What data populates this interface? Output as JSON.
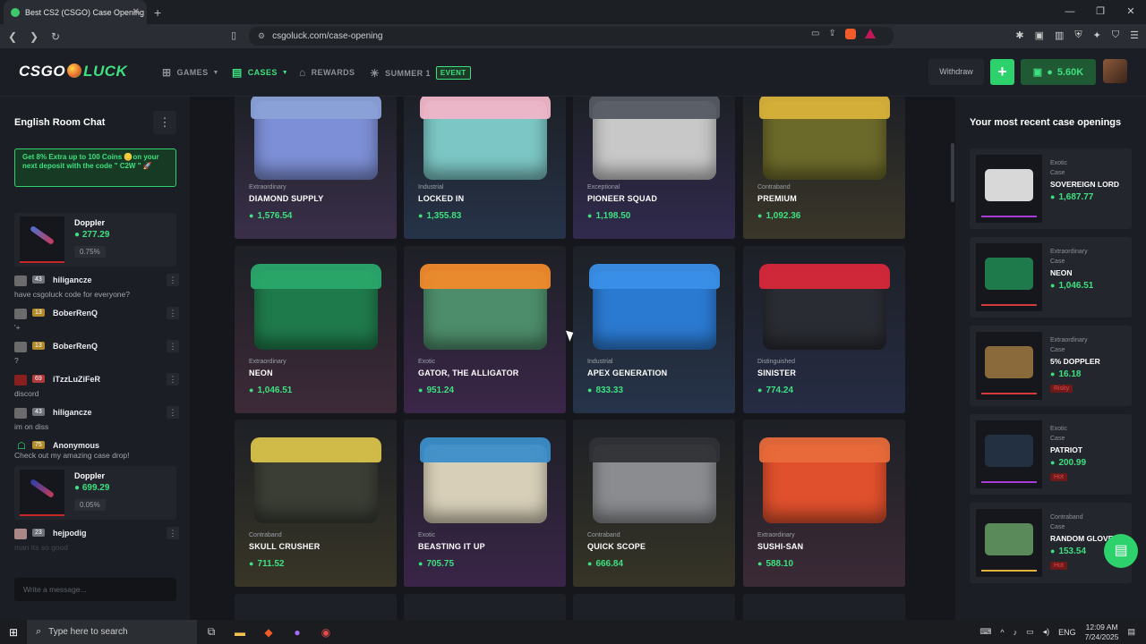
{
  "browser": {
    "tab_title": "Best CS2 (CSGO) Case Opening",
    "url": "csgoluck.com/case-opening"
  },
  "header": {
    "logo_left": "CSGO",
    "logo_right": "LUCK",
    "nav": [
      {
        "label": "GAMES",
        "has_caret": true
      },
      {
        "label": "CASES",
        "has_caret": true
      },
      {
        "label": "REWARDS"
      },
      {
        "label": "SUMMER 1"
      }
    ],
    "event_badge": "EVENT",
    "withdraw_label": "Withdraw",
    "plus_label": "+",
    "balance": "5.60K"
  },
  "chat": {
    "title": "English Room Chat",
    "promo": "Get 8% Extra up to 100 Coins 🪙on your next deposit with the code \" C2W \" 🚀",
    "drop1": {
      "name": "Doppler",
      "price": "277.29",
      "pct": "0.75%"
    },
    "messages": [
      {
        "level": "43",
        "user": "hiligancze",
        "text": "have csgoluck code for everyone?"
      },
      {
        "level": "13",
        "user": "BoberRenQ",
        "text": "'+"
      },
      {
        "level": "13",
        "user": "BoberRenQ",
        "text": "?"
      },
      {
        "level": "69",
        "user": "iTzzLuZiFeR",
        "text": "discord"
      },
      {
        "level": "43",
        "user": "hiligancze",
        "text": "im on diss"
      },
      {
        "level": "75",
        "user": "Anonymous",
        "text": "Check out my amazing case drop!"
      }
    ],
    "drop2": {
      "name": "Doppler",
      "price": "699.29",
      "pct": "0.05%"
    },
    "last_message": {
      "level": "23",
      "user": "hejpodig",
      "text": "man its so good"
    },
    "input_placeholder": "Write a message..."
  },
  "cases": [
    {
      "rarity": "Extraordinary",
      "name": "DIAMOND SUPPLY",
      "price": "1,576.54",
      "bg": "#3a2f4a",
      "color": "#7d8fd6",
      "lid": "#8ba2d8"
    },
    {
      "rarity": "Industrial",
      "name": "LOCKED IN",
      "price": "1,355.83",
      "bg": "#263348",
      "color": "#7cc7c5",
      "lid": "#f1b6c8"
    },
    {
      "rarity": "Exceptional",
      "name": "PIONEER SQUAD",
      "price": "1,198.50",
      "bg": "#312a4e",
      "color": "#c8c8c8",
      "lid": "#555a62"
    },
    {
      "rarity": "Contraband",
      "name": "PREMIUM",
      "price": "1,092.36",
      "bg": "#3a3628",
      "color": "#6c6a2a",
      "lid": "#d9b23a"
    },
    {
      "rarity": "Extraordinary",
      "name": "NEON",
      "price": "1,046.51",
      "bg": "#3d2a38",
      "color": "#1f7a4b",
      "lid": "#2aa86a"
    },
    {
      "rarity": "Exotic",
      "name": "GATOR, THE ALLIGATOR",
      "price": "951.24",
      "bg": "#3b2648",
      "color": "#4d8d6b",
      "lid": "#f08a2a"
    },
    {
      "rarity": "Industrial",
      "name": "APEX GENERATION",
      "price": "833.33",
      "bg": "#26344a",
      "color": "#2b7ad1",
      "lid": "#3a8fe8"
    },
    {
      "rarity": "Distinguished",
      "name": "SINISTER",
      "price": "774.24",
      "bg": "#262c44",
      "color": "#2a2c33",
      "lid": "#d8283a"
    },
    {
      "rarity": "Contraband",
      "name": "SKULL CRUSHER",
      "price": "711.52",
      "bg": "#383526",
      "color": "#3a3e35",
      "lid": "#d9c24a"
    },
    {
      "rarity": "Exotic",
      "name": "BEASTING IT UP",
      "price": "705.75",
      "bg": "#3a2548",
      "color": "#d7cfb8",
      "lid": "#3c8ec9"
    },
    {
      "rarity": "Contraband",
      "name": "QUICK SCOPE",
      "price": "666.84",
      "bg": "#363426",
      "color": "#8a8c90",
      "lid": "#2f3136"
    },
    {
      "rarity": "Extraordinary",
      "name": "SUSHI-SAN",
      "price": "588.10",
      "bg": "#3b2a36",
      "color": "#e0502d",
      "lid": "#e86a3a"
    }
  ],
  "recent": {
    "title": "Your most recent case openings",
    "items": [
      {
        "rarity": "Exotic",
        "kind": "Case",
        "name": "SOVEREIGN LORD",
        "price": "1,687.77",
        "tag": "",
        "box": "#d8d8d8",
        "line": "#a93cd6"
      },
      {
        "rarity": "Extraordinary",
        "kind": "Case",
        "name": "NEON",
        "price": "1,046.51",
        "tag": "",
        "box": "#1f7a4b",
        "line": "#d43c3c"
      },
      {
        "rarity": "Extraordinary",
        "kind": "Case",
        "name": "5% DOPPLER",
        "price": "16.18",
        "tag": "Risky",
        "box": "#8a6a3a",
        "line": "#d43c3c"
      },
      {
        "rarity": "Exotic",
        "kind": "Case",
        "name": "PATRIOT",
        "price": "200.99",
        "tag": "Hot",
        "box": "#223042",
        "line": "#a93cd6"
      },
      {
        "rarity": "Contraband",
        "kind": "Case",
        "name": "RANDOM GLOVE",
        "price": "153.54",
        "tag": "Hot",
        "box": "#5a8a5a",
        "line": "#e0b23a"
      }
    ]
  },
  "taskbar": {
    "search_placeholder": "Type here to search",
    "lang": "ENG",
    "time": "12:09 AM",
    "date": "7/24/2025"
  }
}
